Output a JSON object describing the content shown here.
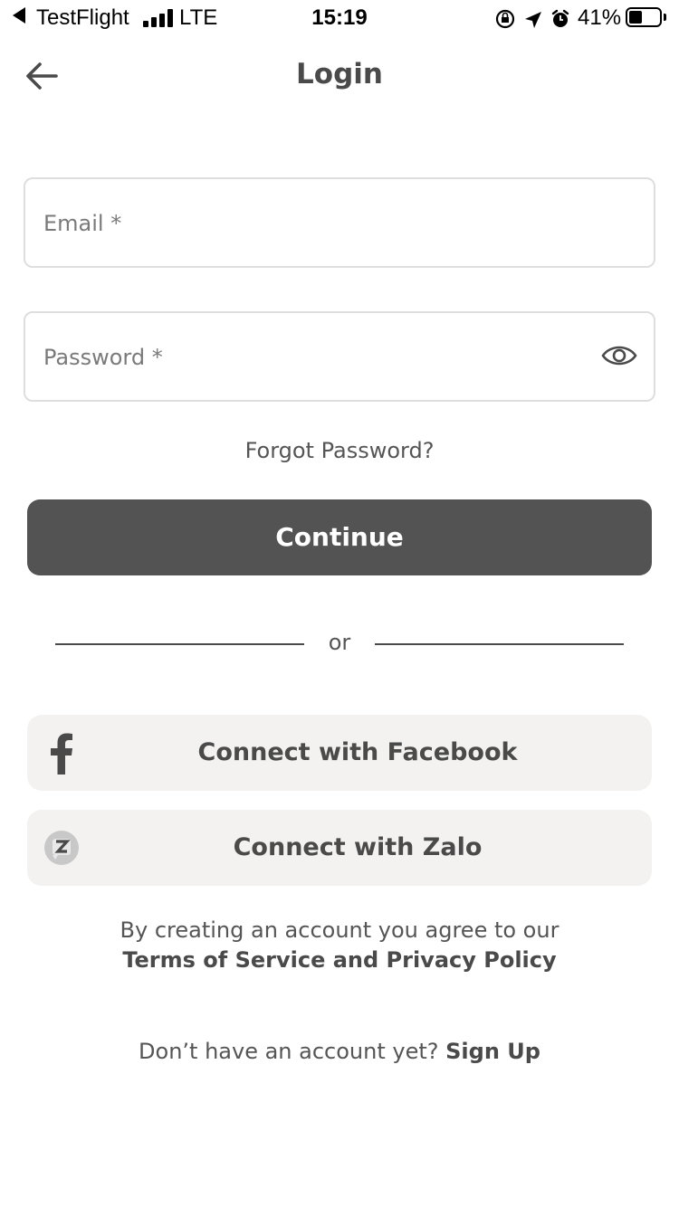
{
  "status_bar": {
    "back_app": "TestFlight",
    "network": "LTE",
    "time": "15:19",
    "battery": "41%"
  },
  "header": {
    "title": "Login",
    "back_icon": "arrow-left-icon"
  },
  "form": {
    "email_placeholder": "Email *",
    "email_value": "",
    "password_placeholder": "Password *",
    "password_value": "",
    "forgot_password": "Forgot Password?",
    "continue_label": "Continue"
  },
  "separator": {
    "text": "or"
  },
  "social": {
    "facebook_label": "Connect with Facebook",
    "zalo_label": "Connect with Zalo"
  },
  "terms": {
    "line1": "By creating an account you agree to our",
    "link": "Terms of Service and Privacy Policy"
  },
  "signup": {
    "prompt": "Don’t have an account yet?",
    "link": "Sign Up"
  },
  "colors": {
    "primary_button": "#535353",
    "social_button_bg": "#f3f2f0",
    "input_border": "#dedede",
    "text": "#4a4a4a"
  }
}
